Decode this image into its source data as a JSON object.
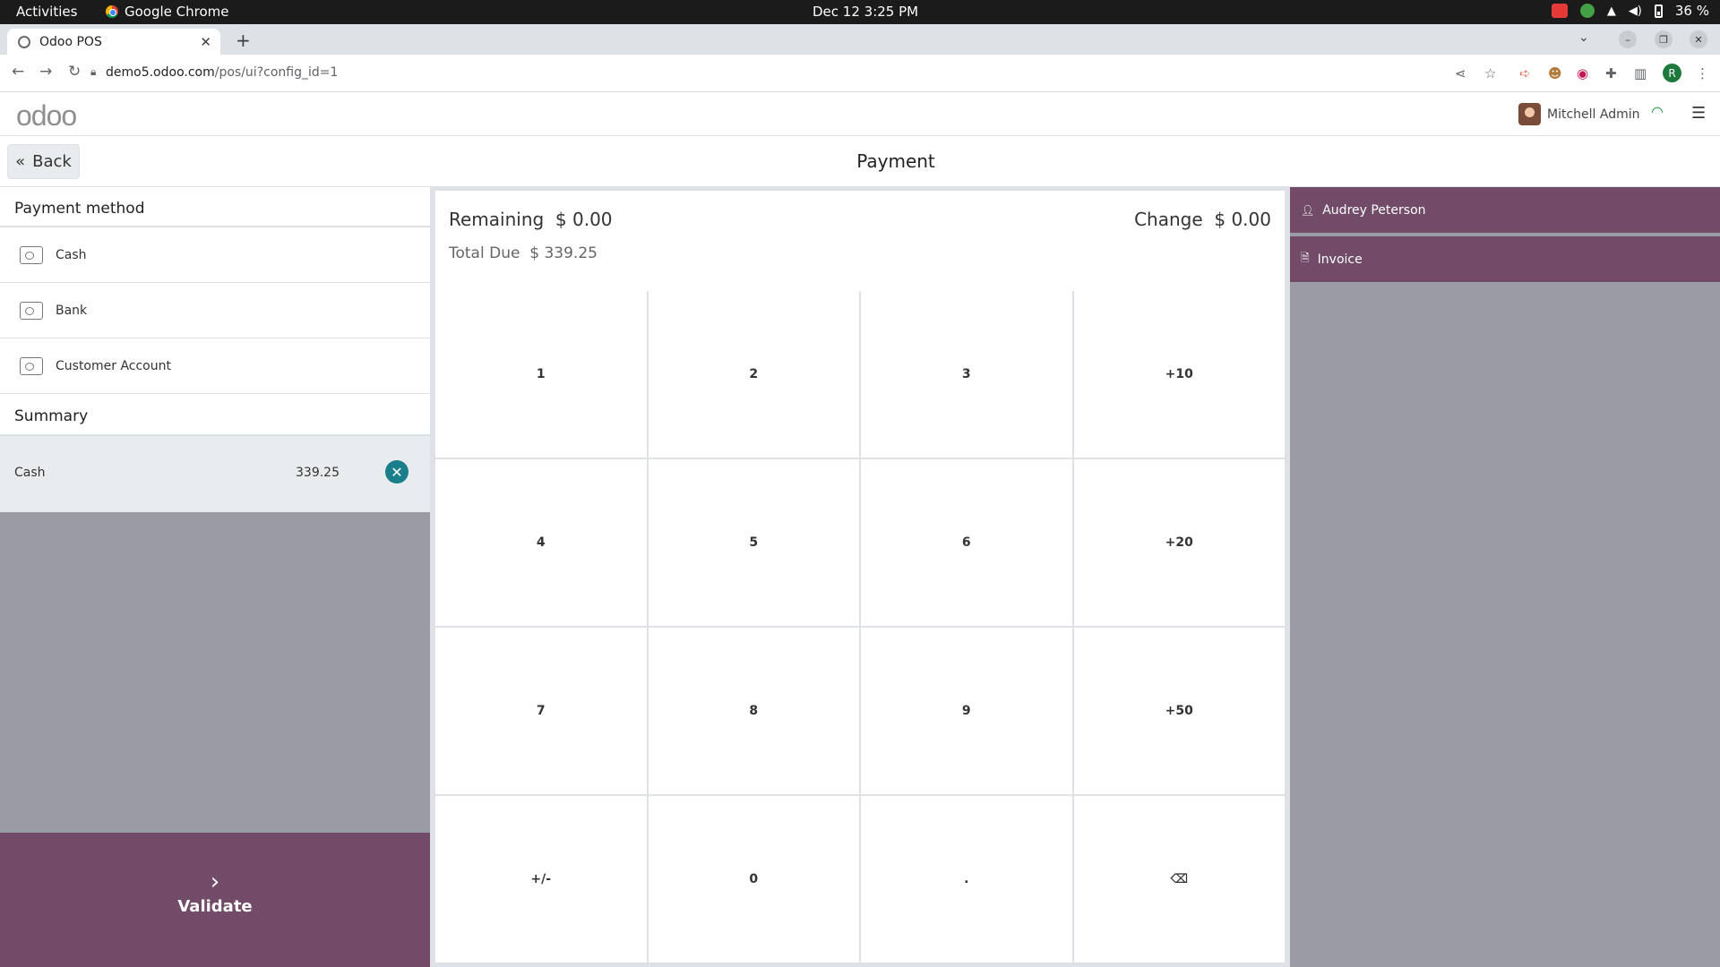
{
  "os": {
    "activities": "Activities",
    "app_name": "Google Chrome",
    "clock": "Dec 12  3:25 PM",
    "battery": "36 %"
  },
  "browser": {
    "tab_title": "Odoo POS",
    "url_host": "demo5.odoo.com",
    "url_path": "/pos/ui?config_id=1",
    "profile_initial": "R"
  },
  "header": {
    "logo": "odoo",
    "user_name": "Mitchell Admin"
  },
  "controls": {
    "back_label": "Back",
    "title": "Payment"
  },
  "payment_methods": {
    "title": "Payment method",
    "items": [
      {
        "label": "Cash",
        "icon": "cash-icon"
      },
      {
        "label": "Bank",
        "icon": "bank-card-icon"
      },
      {
        "label": "Customer Account",
        "icon": "customer-account-icon"
      }
    ]
  },
  "summary": {
    "title": "Summary",
    "lines": [
      {
        "name": "Cash",
        "amount": "339.25"
      }
    ]
  },
  "validate_label": "Validate",
  "status": {
    "remaining_label": "Remaining",
    "remaining_value": "$ 0.00",
    "change_label": "Change",
    "change_value": "$ 0.00",
    "total_due_label": "Total Due",
    "total_due_value": "$ 339.25"
  },
  "numpad": [
    "1",
    "2",
    "3",
    "+10",
    "4",
    "5",
    "6",
    "+20",
    "7",
    "8",
    "9",
    "+50",
    "+/-",
    "0",
    ".",
    "⌫"
  ],
  "actions": {
    "customer": "Audrey Peterson",
    "invoice": "Invoice"
  },
  "colors": {
    "brand": "#714b67",
    "accent_teal": "#1a7f8a"
  }
}
